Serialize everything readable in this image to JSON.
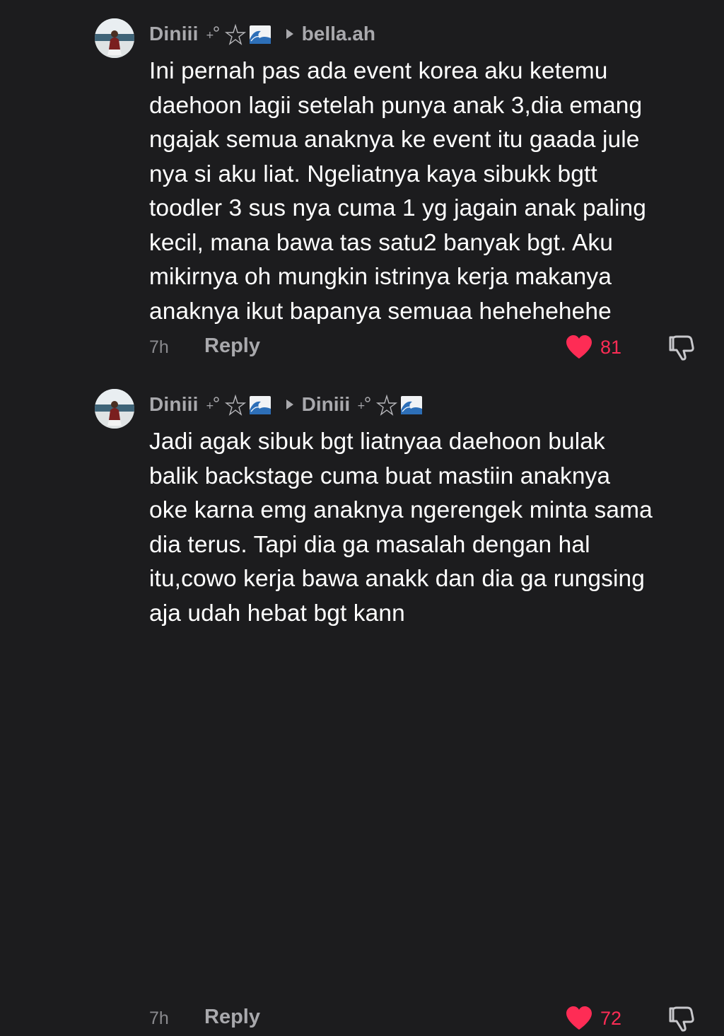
{
  "colors": {
    "background": "#1c1c1e",
    "username": "#a9a9ad",
    "body_text": "#ffffff",
    "timestamp": "#8a8a8e",
    "like_active": "#fe2c55"
  },
  "comments": [
    {
      "username": "Diniii",
      "username_decoration": "⁺˚⋆🌊",
      "reply_to": "bella.ah",
      "reply_to_decoration": "",
      "text": "Ini pernah pas ada event korea aku ketemu\ndaehoon lagii setelah punya anak 3,dia emang\nngajak semua anaknya ke event itu gaada jule\nnya si aku liat. Ngeliatnya kaya sibukk bgtt\ntoodler 3 sus nya cuma 1 yg jagain anak paling\nkecil, mana bawa tas satu2 banyak bgt. Aku\nmikirnya oh mungkin istrinya kerja makanya\nanaknya ikut bapanya semuaa hehehehehe",
      "time": "7h",
      "reply_label": "Reply",
      "likes": "81",
      "liked": true,
      "avatar_icon": "profile-photo-avatar",
      "like_icon": "heart-icon",
      "dislike_icon": "thumbs-down-icon"
    },
    {
      "username": "Diniii",
      "username_decoration": "⁺˚⋆🌊",
      "reply_to": "Diniii",
      "reply_to_decoration": "⁺˚⋆🌊",
      "text": "Jadi agak sibuk bgt liatnyaa daehoon bulak\nbalik backstage cuma buat mastiin anaknya\noke karna emg anaknya ngerengek minta sama\ndia terus. Tapi dia ga masalah dengan hal\nitu,cowo kerja bawa anakk dan dia ga rungsing\naja udah hebat bgt kann",
      "time": "7h",
      "reply_label": "Reply",
      "likes": "72",
      "liked": true,
      "avatar_icon": "profile-photo-avatar",
      "like_icon": "heart-icon",
      "dislike_icon": "thumbs-down-icon"
    }
  ]
}
